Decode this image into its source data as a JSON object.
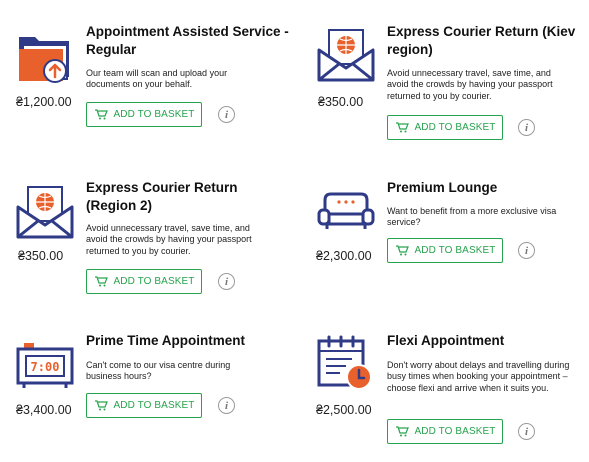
{
  "colors": {
    "accent_green": "#27a34d",
    "icon_navy": "#2f3b86",
    "icon_orange": "#e8612c"
  },
  "services": [
    {
      "icon": "folder-upload-icon",
      "title": "Appointment Assisted Service - Regular",
      "description": "Our team will scan and upload your documents on your behalf.",
      "price": "₴1,200.00",
      "button_label": "ADD TO BASKET",
      "info_label": "i"
    },
    {
      "icon": "envelope-globe-icon",
      "title": "Express Courier Return (Kiev region)",
      "description": "Avoid unnecessary travel, save time, and avoid the crowds by having your passport returned to you by courier.",
      "price": "₴350.00",
      "button_label": "ADD TO BASKET",
      "info_label": "i"
    },
    {
      "icon": "envelope-globe-icon",
      "title": "Express Courier Return (Region 2)",
      "description": "Avoid unnecessary travel, save time, and avoid the crowds by having your passport returned to you by courier.",
      "price": "₴350.00",
      "button_label": "ADD TO BASKET",
      "info_label": "i"
    },
    {
      "icon": "sofa-icon",
      "title": "Premium Lounge",
      "description": "Want to benefit from a more exclusive visa service?",
      "price": "₴2,300.00",
      "button_label": "ADD TO BASKET",
      "info_label": "i"
    },
    {
      "icon": "digital-clock-icon",
      "title": "Prime Time Appointment",
      "description": "Can't come to our visa centre during business hours?",
      "price": "₴3,400.00",
      "button_label": "ADD TO BASKET",
      "info_label": "i",
      "icon_text": "7:00"
    },
    {
      "icon": "calendar-clock-icon",
      "title": "Flexi Appointment",
      "description": "Don't worry about delays and travelling during busy times when booking your appointment – choose flexi and arrive when it suits you.",
      "price": "₴2,500.00",
      "button_label": "ADD TO BASKET",
      "info_label": "i"
    }
  ]
}
